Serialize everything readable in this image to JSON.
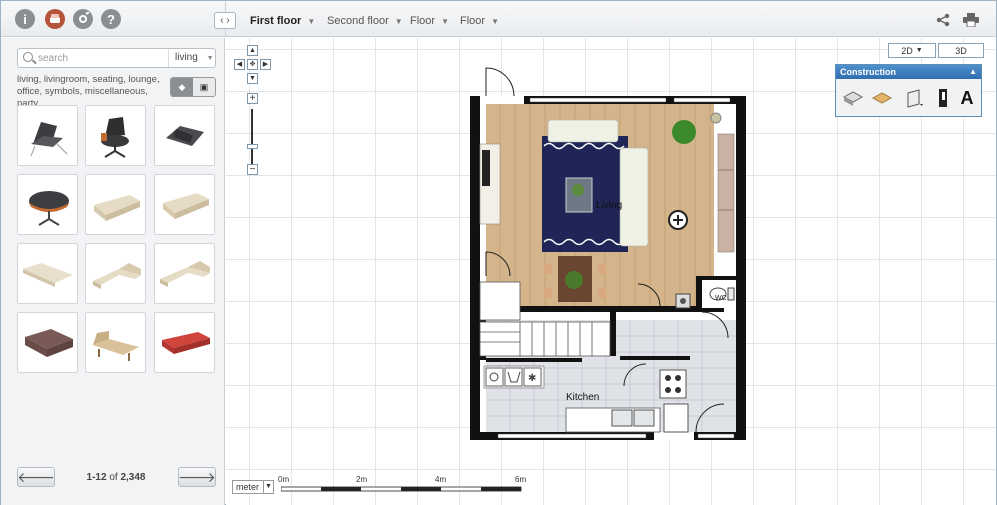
{
  "toolbar": {
    "icons": [
      "info-icon",
      "furniture-icon",
      "settings-icon",
      "help-icon"
    ],
    "floor_tabs": [
      "First floor",
      "Second floor",
      "Floor",
      "Floor"
    ],
    "active_floor": "First floor",
    "right_icons": [
      "share-icon",
      "print-icon"
    ]
  },
  "sidebar": {
    "search_placeholder": "search",
    "category": "living",
    "tags": "living, livingroom, seating, lounge, office, symbols, miscellaneous, party,",
    "items": [
      "lounge chair",
      "eames lounge chair",
      "recliner",
      "ottoman",
      "sofa",
      "sofa",
      "long sofa",
      "corner sofa",
      "corner sofa",
      "brown sofa",
      "chaise longue",
      "red sofa"
    ],
    "pager": {
      "range": "1-12",
      "of": "of",
      "total": "2,348"
    }
  },
  "canvas": {
    "view_2d": "2D",
    "view_3d": "3D",
    "panel_title": "Construction",
    "rooms": [
      "Living",
      "Kitchen"
    ],
    "wc_label": "WC",
    "unit": "meter",
    "scale": [
      "0m",
      "2m",
      "4m",
      "6m"
    ]
  },
  "colors": {
    "accent": "#3a7bbf",
    "wall": "#111111",
    "wood": "#d4b48a",
    "rug": "#1f2556"
  }
}
